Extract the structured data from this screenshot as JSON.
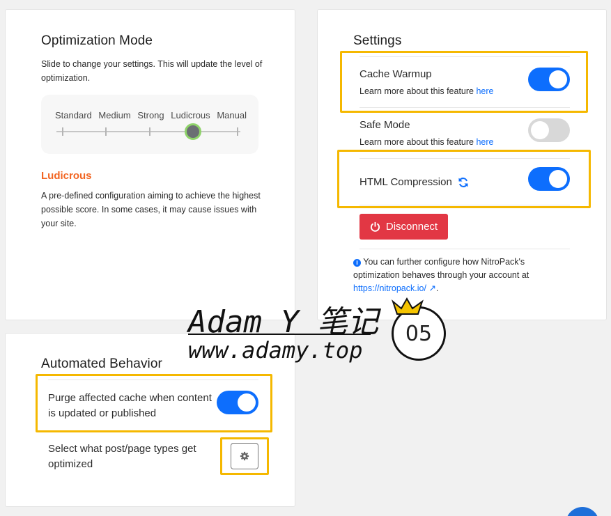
{
  "optimization": {
    "title": "Optimization Mode",
    "description": "Slide to change your settings. This will update the level of optimization.",
    "levels": [
      "Standard",
      "Medium",
      "Strong",
      "Ludicrous",
      "Manual"
    ],
    "selected_level": "Ludicrous",
    "selected_description": "A pre-defined configuration aiming to achieve the highest possible score. In some cases, it may cause issues with your site."
  },
  "settings": {
    "title": "Settings",
    "cache_warmup": {
      "label": "Cache Warmup",
      "help": "Learn more about this feature",
      "link": "here",
      "enabled": true
    },
    "safe_mode": {
      "label": "Safe Mode",
      "help": "Learn more about this feature",
      "link": "here",
      "enabled": false
    },
    "html_compression": {
      "label": "HTML Compression",
      "enabled": true
    },
    "disconnect_label": "Disconnect",
    "info_text": "You can further configure how NitroPack's optimization behaves through your account at",
    "info_link": "https://nitropack.io/"
  },
  "automated": {
    "title": "Automated Behavior",
    "purge_label": "Purge affected cache when content is updated or published",
    "purge_enabled": true,
    "post_types_label": "Select what post/page types get optimized"
  },
  "watermark": {
    "name": "Adam Y 笔记",
    "url": "www.adamy.top",
    "badge": "05"
  },
  "colors": {
    "accent": "#0d6efd",
    "danger": "#e23744",
    "highlight": "#f5b800",
    "ludicrous": "#f26522"
  }
}
